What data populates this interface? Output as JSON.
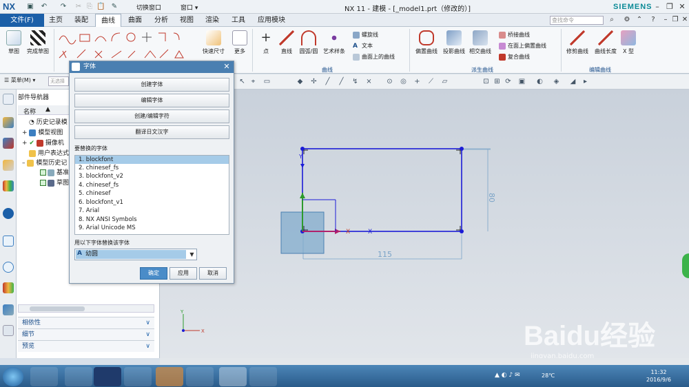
{
  "app": {
    "logo": "NX",
    "title": "NX 11 - 建模 - [_model1.prt（修改的）]",
    "brand": "SIEMENS",
    "switch_window": "切换窗口",
    "window": "窗口"
  },
  "menu": {
    "file": "文件(F)",
    "tabs": [
      "主页",
      "装配",
      "曲线",
      "曲面",
      "分析",
      "视图",
      "渲染",
      "工具",
      "应用模块"
    ],
    "active": "曲线",
    "search_placeholder": "查找命令"
  },
  "ribbon": {
    "sketch": "草图",
    "finish_sketch": "完成草图",
    "quick_dim": "快速尺寸",
    "more": "更多",
    "point": "点",
    "line": "直线",
    "arc": "圆弧/圆",
    "art_spline": "艺术样条",
    "helix": "螺旋线",
    "text": "文本",
    "curve_on_surface": "曲面上的曲线",
    "offset_curve": "偏置曲线",
    "project_curve": "投影曲线",
    "intersect_curve": "相交曲线",
    "bridge_curve": "桥接曲线",
    "offset_on_face": "在面上偏置曲线",
    "composite_curve": "复合曲线",
    "trim_curve": "修剪曲线",
    "curve_length": "曲线长度",
    "x_type": "X 型",
    "groups": {
      "curve": "曲线",
      "derived": "派生曲线",
      "edit": "编辑曲线"
    }
  },
  "toolbar": {
    "menu": "菜单(M)",
    "filter_placeholder": "无选择"
  },
  "navigator": {
    "title": "部件导航器",
    "column": "名称",
    "items": [
      "历史记录模",
      "模型视图",
      "摄像机",
      "用户表达式",
      "模型历史记",
      "基准",
      "草图"
    ],
    "accordions": [
      "相依性",
      "细节",
      "预览"
    ]
  },
  "dialog": {
    "title": "字体",
    "buttons": [
      "创建字体",
      "编辑字体",
      "创建/编辑字符",
      "翻译日文汉字"
    ],
    "list_label": "要替换的字体",
    "fonts": [
      "1. blockfont",
      "2. chinesef_fs",
      "3. blockfont_v2",
      "4. chinesef_fs",
      "5. chinesef",
      "6. blockfont_v1",
      "7. Arial",
      "8. NX ANSI Symbols",
      "9. Arial Unicode MS"
    ],
    "selected_index": 0,
    "replace_label": "用以下字体替换该字体",
    "replace_value": "幼圆",
    "ok": "确定",
    "apply": "应用",
    "cancel": "取消"
  },
  "sketch": {
    "dim_width": "115",
    "dim_height": "80"
  },
  "taskbar": {
    "temp": "28℃",
    "time": "11:32",
    "date": "2016/9/6"
  },
  "watermark": {
    "text": "Baidu经验",
    "url": "jingyan.baidu.com"
  },
  "colors": {
    "accent": "#1b5fa8",
    "dialog_header": "#4a7fb1",
    "selection": "#a5cbe8",
    "sketch_blue": "#1b1bd6"
  }
}
